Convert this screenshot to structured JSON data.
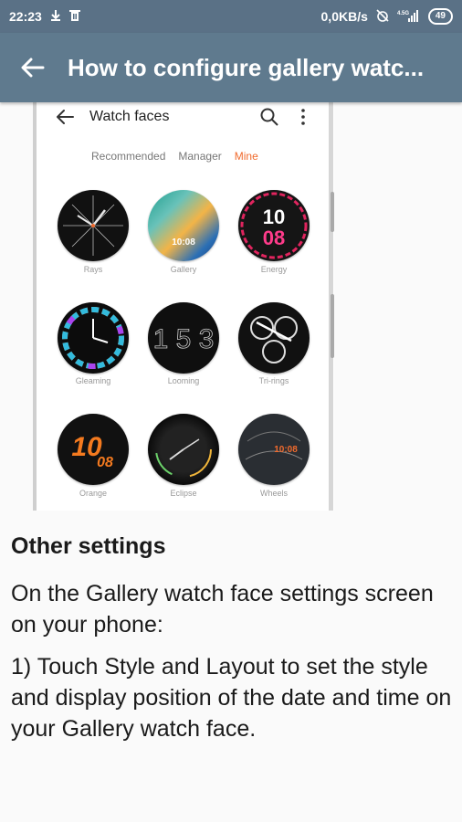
{
  "status_bar": {
    "time": "22:23",
    "net_speed": "0,0KB/s",
    "network": "4.5G",
    "battery": "49",
    "icons": [
      "download-icon",
      "trash-icon",
      "no-alarm-icon",
      "signal-icon"
    ]
  },
  "app_bar": {
    "title": "How to configure gallery watc..."
  },
  "screenshot": {
    "header_title": "Watch faces",
    "tabs": [
      {
        "label": "Recommended",
        "active": false
      },
      {
        "label": "Manager",
        "active": false
      },
      {
        "label": "Mine",
        "active": true
      }
    ],
    "faces": [
      {
        "label": "Rays",
        "digits": ""
      },
      {
        "label": "Gallery",
        "digits": "10:08"
      },
      {
        "label": "Energy",
        "digits": "10",
        "digits2": "08"
      },
      {
        "label": "Gleaming",
        "digits": ""
      },
      {
        "label": "Looming",
        "digits": "1 5 3"
      },
      {
        "label": "Tri-rings",
        "digits": ""
      },
      {
        "label": "Orange",
        "digits": "10",
        "digits2": "08"
      },
      {
        "label": "Eclipse",
        "digits": ""
      },
      {
        "label": "Wheels",
        "digits": "10:08"
      }
    ]
  },
  "article": {
    "heading": "Other settings",
    "paragraph1": "On the Gallery watch face settings screen on your phone:",
    "paragraph2": "1) Touch Style and Layout to set the style and display position of the date and time on your Gallery watch face."
  },
  "colors": {
    "status_bar": "#5a7186",
    "app_bar": "#5f7a8e",
    "accent": "#f06a2d"
  }
}
